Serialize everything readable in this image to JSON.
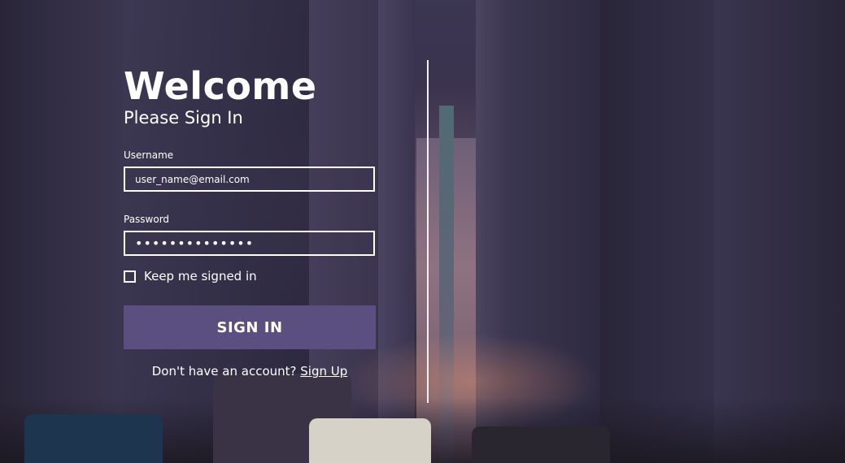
{
  "header": {
    "title": "Welcome",
    "subtitle": "Please Sign In"
  },
  "form": {
    "username_label": "Username",
    "username_value": "user_name@email.com",
    "password_label": "Password",
    "password_value": "••••••••••••••",
    "remember_label": "Keep me signed in",
    "remember_checked": false,
    "signin_label": "SIGN IN"
  },
  "footer": {
    "prompt": "Don't have an account?",
    "signup_link": "Sign Up"
  },
  "colors": {
    "accent": "#5a4f7e",
    "text": "#ffffff",
    "background": "#2e2a42"
  }
}
